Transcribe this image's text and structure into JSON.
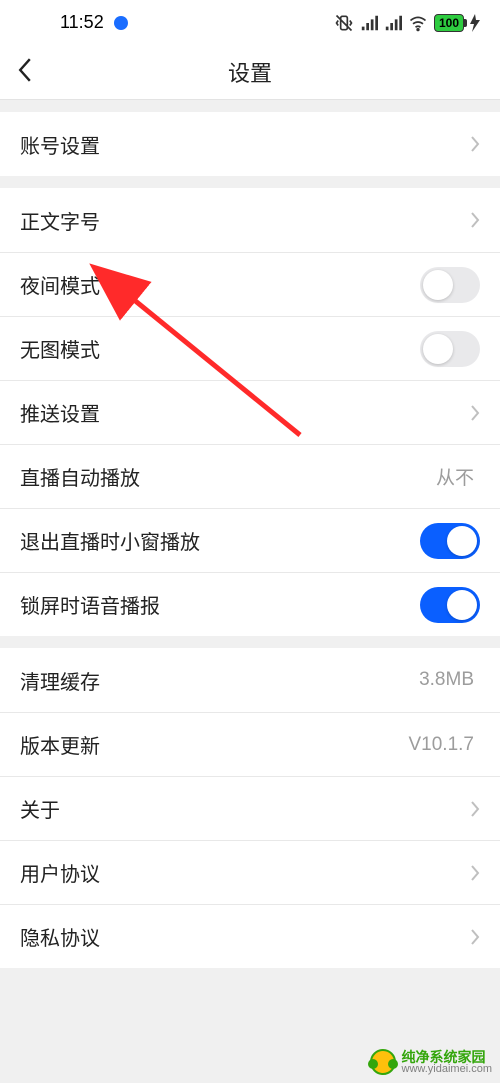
{
  "status": {
    "time": "11:52",
    "battery_pct": "100"
  },
  "header": {
    "title": "设置"
  },
  "groups": {
    "account": {
      "account_settings": "账号设置"
    },
    "display": {
      "font_size": "正文字号",
      "night_mode": "夜间模式",
      "no_image_mode": "无图模式",
      "push_settings": "推送设置",
      "live_autoplay_label": "直播自动播放",
      "live_autoplay_value": "从不",
      "exit_live_pip": "退出直播时小窗播放",
      "lock_voice_broadcast": "锁屏时语音播报"
    },
    "system": {
      "clear_cache_label": "清理缓存",
      "clear_cache_value": "3.8MB",
      "version_update_label": "版本更新",
      "version_update_value": "V10.1.7",
      "about": "关于",
      "user_agreement": "用户协议",
      "privacy_agreement": "隐私协议"
    }
  },
  "watermark": {
    "brand_cn": "纯净系统家园",
    "url": "www.yidaimei.com"
  },
  "annotation": {
    "arrow_color": "#ff2a2a"
  }
}
